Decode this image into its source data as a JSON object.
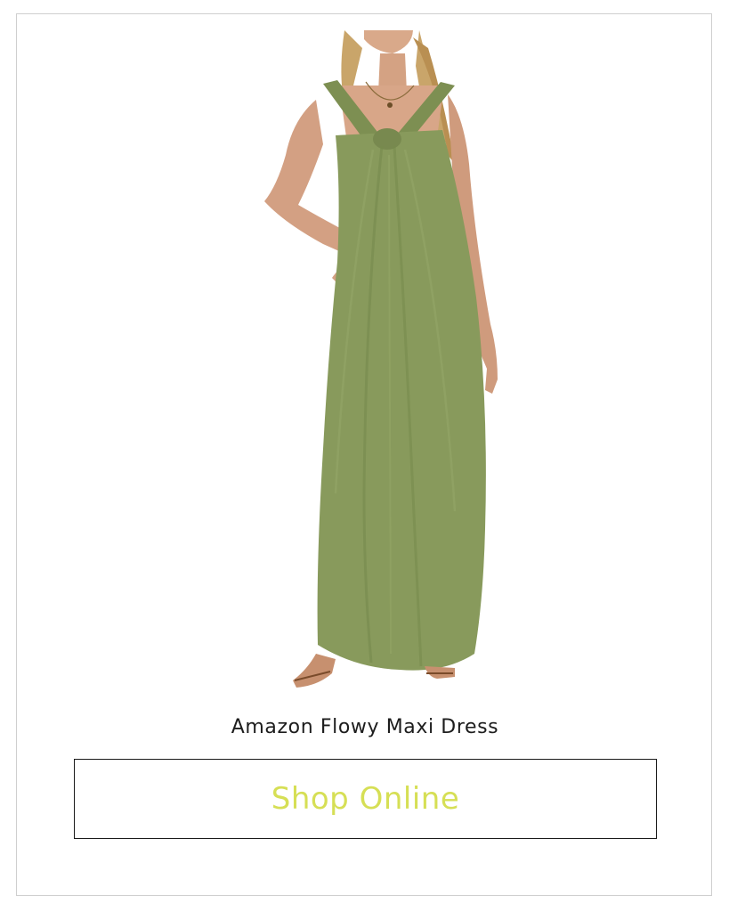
{
  "product": {
    "title": "Amazon Flowy Maxi Dress",
    "image_alt": "Model wearing olive green halter-neck flowy maxi dress",
    "dress_color": "#889a5c"
  },
  "cta": {
    "label": "Shop Online",
    "label_color": "#d6df55"
  }
}
